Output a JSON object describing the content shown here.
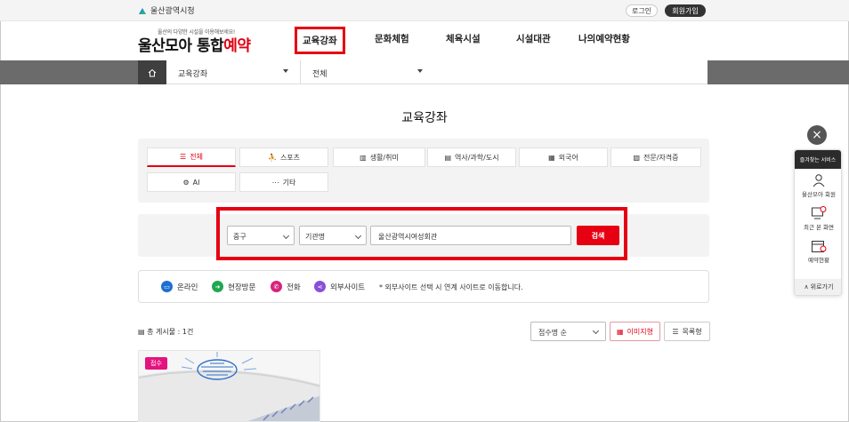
{
  "topbar": {
    "city": "울산광역시청",
    "login": "로그인",
    "join": "회원가입"
  },
  "header": {
    "logo_sub": "울산의 다양한 시설을 이용해보세요!",
    "logo_main": "울산모아 통합",
    "logo_accent": "예약",
    "nav": [
      "교육강좌",
      "문화체험",
      "체육시설",
      "시설대관",
      "나의예약현황"
    ]
  },
  "location": {
    "depth1": "교육강좌",
    "depth2": "전체"
  },
  "page_title": "교육강좌",
  "categories": [
    {
      "label": "전체",
      "icon": "list-icon"
    },
    {
      "label": "스포츠",
      "icon": "runner-icon"
    },
    {
      "label": "생활/취미",
      "icon": "piano-icon"
    },
    {
      "label": "역사/과학/도시",
      "icon": "book-icon"
    },
    {
      "label": "외국어",
      "icon": "building-icon"
    },
    {
      "label": "전문/자격증",
      "icon": "certificate-icon"
    },
    {
      "label": "AI",
      "icon": "robot-icon"
    },
    {
      "label": "기타",
      "icon": "dots-icon"
    }
  ],
  "search": {
    "district": "중구",
    "agency": "기관명",
    "keyword": "울산광역시여성회관",
    "button": "검색"
  },
  "legend": {
    "items": [
      {
        "label": "온라인",
        "color": "#1f6fd1",
        "icon": "monitor-icon"
      },
      {
        "label": "현장방문",
        "color": "#1fa84f",
        "icon": "arrow-icon"
      },
      {
        "label": "전화",
        "color": "#d6247d",
        "icon": "phone-icon"
      },
      {
        "label": "외부사이트",
        "color": "#8a4fd8",
        "icon": "share-icon"
      }
    ],
    "note": "* 외부사이트 선택 시 연계 사이트로 이동합니다."
  },
  "results": {
    "count_label": "총 게시물 : 1건",
    "sort": "접수명 순",
    "view_image": "이미지형",
    "view_list": "목록형"
  },
  "card": {
    "badge": "접수"
  },
  "quick": {
    "title": "즐겨찾는 서비스",
    "items": [
      "울산모아 회원",
      "최근 본 화면",
      "예약현황"
    ],
    "top": "위로가기"
  },
  "colors": {
    "accent": "#e60012",
    "dark": "#2b2b2b"
  }
}
